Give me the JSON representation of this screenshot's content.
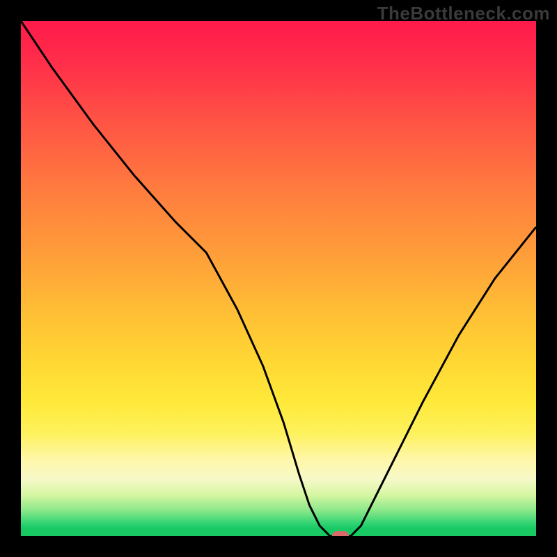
{
  "watermark": "TheBottleneck.com",
  "colors": {
    "barrier_top": "#ff1a4b",
    "barrier_bottom": "#18c964",
    "curve_stroke": "#000000",
    "marker_fill": "#d86a6a",
    "frame_bg": "#000000"
  },
  "chart_data": {
    "type": "line",
    "title": "",
    "xlabel": "",
    "ylabel": "",
    "xlim": [
      0,
      100
    ],
    "ylim": [
      0,
      100
    ],
    "legend": false,
    "grid": false,
    "series": [
      {
        "name": "bottleneck-curve",
        "x": [
          0,
          6,
          14,
          22,
          30,
          36,
          42,
          47,
          51,
          54,
          56,
          58,
          60,
          62,
          64,
          66,
          68,
          72,
          78,
          85,
          92,
          100
        ],
        "values": [
          100,
          91,
          80,
          70,
          61,
          55,
          44,
          33,
          22,
          12,
          6,
          2,
          0,
          0,
          0,
          2,
          6,
          14,
          26,
          39,
          50,
          60
        ]
      }
    ],
    "marker": {
      "x": 62,
      "y": 0
    }
  }
}
